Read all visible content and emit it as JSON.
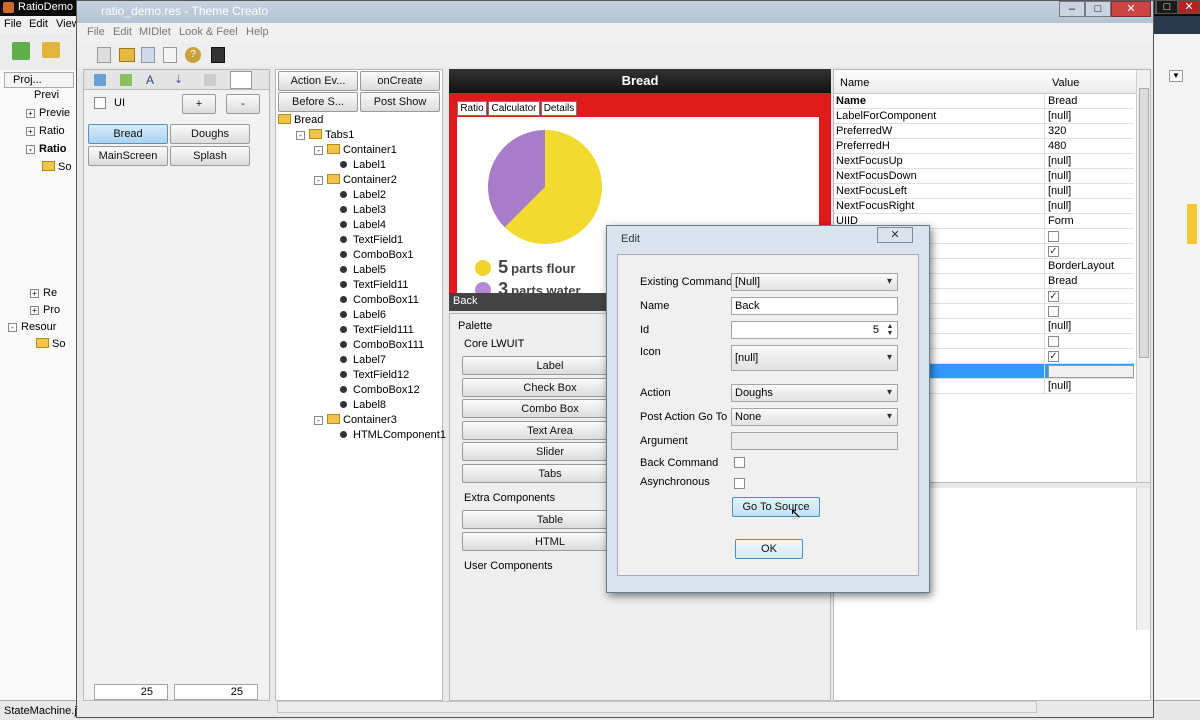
{
  "outer": {
    "title": "RatioDemo",
    "menu": [
      "File",
      "Edit",
      "View"
    ],
    "tabs": [
      "Proj..."
    ],
    "tree": [
      "Previ",
      "Previe",
      "Ratio",
      "Ratio",
      "So",
      "Re",
      "Pro",
      "Resour",
      "So"
    ],
    "status": "StateMachine.ja"
  },
  "inner": {
    "title": "ratio_demo.res - Theme Creato",
    "menu": [
      "File",
      "Edit",
      "MIDlet",
      "Look & Feel",
      "Help"
    ]
  },
  "ui_panel": {
    "label": "UI",
    "plus": "+",
    "minus": "-",
    "forms": [
      "Bread",
      "Doughs",
      "MainScreen",
      "Splash"
    ],
    "spinner_left": "25",
    "spinner_right": "25"
  },
  "event_buttons": {
    "action": "Action Ev...",
    "oncreate": "onCreate",
    "before": "Before S...",
    "postshow": "Post Show"
  },
  "component_tree": [
    {
      "label": "Bread",
      "level": 0,
      "type": "folder"
    },
    {
      "label": "Tabs1",
      "level": 1,
      "type": "folder"
    },
    {
      "label": "Container1",
      "level": 2,
      "type": "folder"
    },
    {
      "label": "Label1",
      "level": 3,
      "type": "leaf"
    },
    {
      "label": "Container2",
      "level": 2,
      "type": "folder"
    },
    {
      "label": "Label2",
      "level": 3,
      "type": "leaf"
    },
    {
      "label": "Label3",
      "level": 3,
      "type": "leaf"
    },
    {
      "label": "Label4",
      "level": 3,
      "type": "leaf"
    },
    {
      "label": "TextField1",
      "level": 3,
      "type": "leaf"
    },
    {
      "label": "ComboBox1",
      "level": 3,
      "type": "leaf"
    },
    {
      "label": "Label5",
      "level": 3,
      "type": "leaf"
    },
    {
      "label": "TextField11",
      "level": 3,
      "type": "leaf"
    },
    {
      "label": "ComboBox11",
      "level": 3,
      "type": "leaf"
    },
    {
      "label": "Label6",
      "level": 3,
      "type": "leaf"
    },
    {
      "label": "TextField111",
      "level": 3,
      "type": "leaf"
    },
    {
      "label": "ComboBox111",
      "level": 3,
      "type": "leaf"
    },
    {
      "label": "Label7",
      "level": 3,
      "type": "leaf"
    },
    {
      "label": "TextField12",
      "level": 3,
      "type": "leaf"
    },
    {
      "label": "ComboBox12",
      "level": 3,
      "type": "leaf"
    },
    {
      "label": "Label8",
      "level": 3,
      "type": "leaf"
    },
    {
      "label": "Container3",
      "level": 2,
      "type": "folder"
    },
    {
      "label": "HTMLComponent1",
      "level": 3,
      "type": "leaf"
    }
  ],
  "preview": {
    "title": "Bread",
    "tabs": [
      "Ratio",
      "Calculator",
      "Details"
    ],
    "legend": [
      {
        "num": "5",
        "text": "parts flour",
        "color": "#f0d62a"
      },
      {
        "num": "3",
        "text": "parts water",
        "color": "#b48ad6"
      }
    ],
    "back": "Back",
    "pie": [
      {
        "value": 5,
        "color": "#f2da2e"
      },
      {
        "value": 3,
        "color": "#a77cc8"
      }
    ]
  },
  "palette": {
    "title": "Palette",
    "core": "Core LWUIT",
    "core_items": [
      "Label",
      "Check Box",
      "Combo Box",
      "Text Area",
      "Slider",
      "Tabs"
    ],
    "extra": "Extra Components",
    "extra_items": [
      "Table",
      "HTML"
    ],
    "user": "User Components"
  },
  "properties": {
    "col_name": "Name",
    "col_value": "Value",
    "rows": [
      {
        "name": "Name",
        "value": "Bread",
        "bold": true
      },
      {
        "name": "LabelForComponent",
        "value": "[null]"
      },
      {
        "name": "PreferredW",
        "value": "320"
      },
      {
        "name": "PreferredH",
        "value": "480"
      },
      {
        "name": "NextFocusUp",
        "value": "[null]"
      },
      {
        "name": "NextFocusDown",
        "value": "[null]"
      },
      {
        "name": "NextFocusLeft",
        "value": "[null]"
      },
      {
        "name": "NextFocusRight",
        "value": "[null]"
      },
      {
        "name": "UIID",
        "value": "Form"
      },
      {
        "name": "",
        "value": "",
        "check": false
      },
      {
        "name": "",
        "value": "",
        "check": true
      },
      {
        "name": "",
        "value": "BorderLayout"
      },
      {
        "name": "",
        "value": "Bread"
      },
      {
        "name": "",
        "value": "",
        "check": true
      },
      {
        "name": "",
        "value": "",
        "check": false
      },
      {
        "name": "",
        "value": "[null]"
      },
      {
        "name": "",
        "value": "",
        "check": false
      },
      {
        "name": "",
        "value": "",
        "check": true
      },
      {
        "name": "",
        "value": "",
        "selected": true
      },
      {
        "name": "",
        "value": "[null]"
      }
    ]
  },
  "dialog": {
    "title": "Edit",
    "existing_commands_label": "Existing Commands",
    "existing_commands_value": "[Null]",
    "name_label": "Name",
    "name_value": "Back",
    "id_label": "Id",
    "id_value": "5",
    "icon_label": "Icon",
    "icon_value": "[null]",
    "action_label": "Action",
    "action_value": "Doughs",
    "post_action_label": "Post Action Go To",
    "post_action_value": "None",
    "argument_label": "Argument",
    "argument_value": "",
    "back_command_label": "Back Command",
    "async_label": "Asynchronous",
    "go_to_source": "Go To Source",
    "ok": "OK"
  },
  "colors": {
    "accent": "#3399ff",
    "preview_red": "#e01b1b",
    "titlebar": "#0a0a0a"
  }
}
